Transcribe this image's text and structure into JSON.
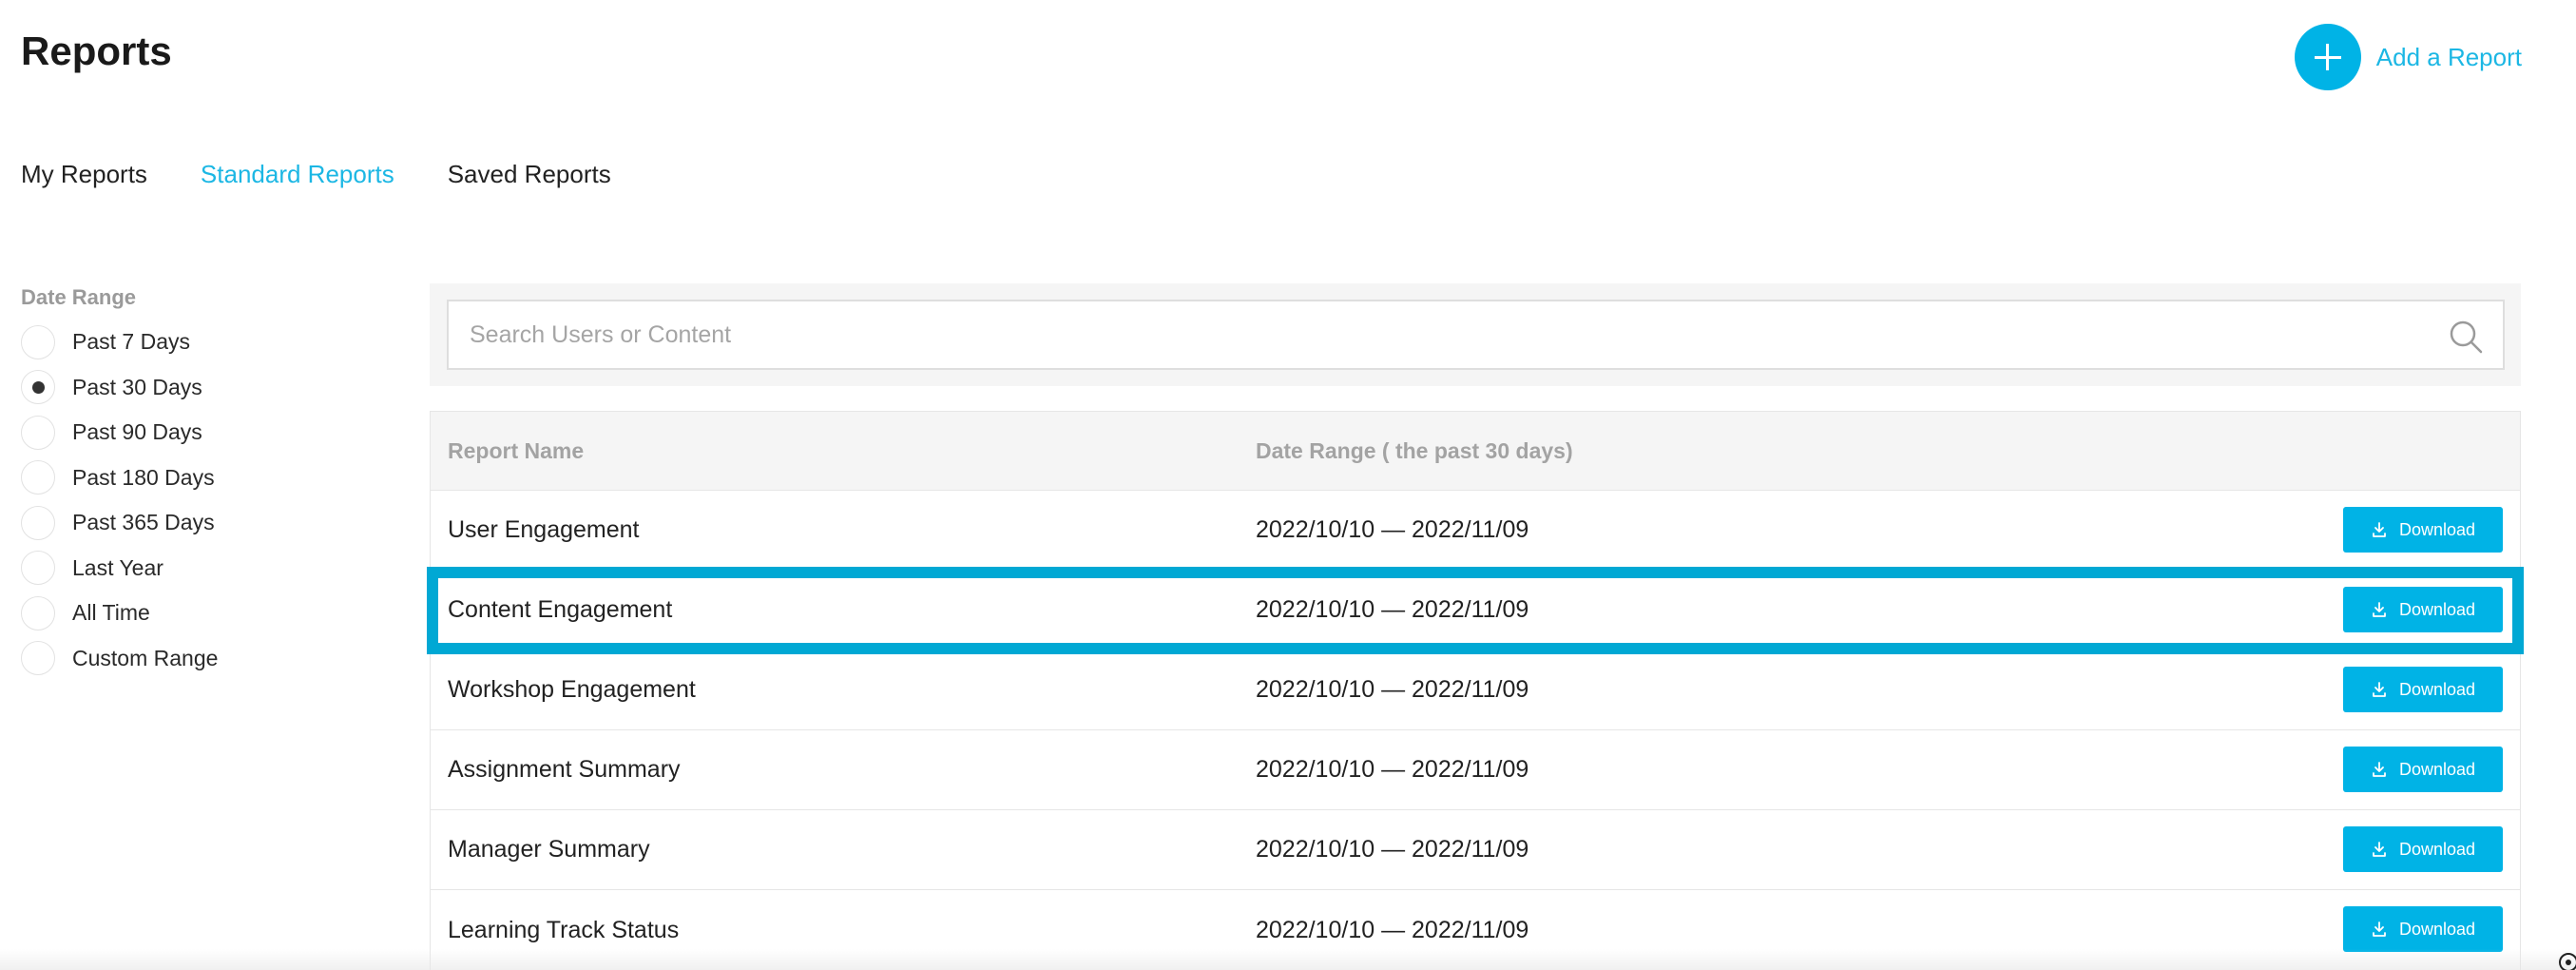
{
  "page": {
    "title": "Reports"
  },
  "header": {
    "add_report_label": "Add a Report"
  },
  "tabs": [
    {
      "label": "My Reports",
      "active": false
    },
    {
      "label": "Standard Reports",
      "active": true
    },
    {
      "label": "Saved Reports",
      "active": false
    }
  ],
  "filters": {
    "title": "Date Range",
    "options": [
      {
        "label": "Past 7 Days",
        "checked": false
      },
      {
        "label": "Past 30 Days",
        "checked": true
      },
      {
        "label": "Past 90 Days",
        "checked": false
      },
      {
        "label": "Past 180 Days",
        "checked": false
      },
      {
        "label": "Past 365 Days",
        "checked": false
      },
      {
        "label": "Last Year",
        "checked": false
      },
      {
        "label": "All Time",
        "checked": false
      },
      {
        "label": "Custom Range",
        "checked": false
      }
    ]
  },
  "search": {
    "placeholder": "Search Users or Content",
    "value": ""
  },
  "table": {
    "headers": {
      "name": "Report Name",
      "date": "Date Range ( the past 30 days)"
    },
    "download_label": "Download",
    "rows": [
      {
        "name": "User Engagement",
        "date": "2022/10/10 — 2022/11/09",
        "highlighted": false
      },
      {
        "name": "Content Engagement",
        "date": "2022/10/10 — 2022/11/09",
        "highlighted": true
      },
      {
        "name": "Workshop Engagement",
        "date": "2022/10/10 — 2022/11/09",
        "highlighted": false
      },
      {
        "name": "Assignment Summary",
        "date": "2022/10/10 — 2022/11/09",
        "highlighted": false
      },
      {
        "name": "Manager Summary",
        "date": "2022/10/10 — 2022/11/09",
        "highlighted": false
      },
      {
        "name": "Learning Track Status",
        "date": "2022/10/10 — 2022/11/09",
        "highlighted": false
      }
    ]
  },
  "colors": {
    "accent": "#00b3e6",
    "highlight": "#00a8d4",
    "muted": "#a3a3a3"
  },
  "icons": {
    "add": "plus-icon",
    "search": "search-icon",
    "download": "download-icon"
  }
}
